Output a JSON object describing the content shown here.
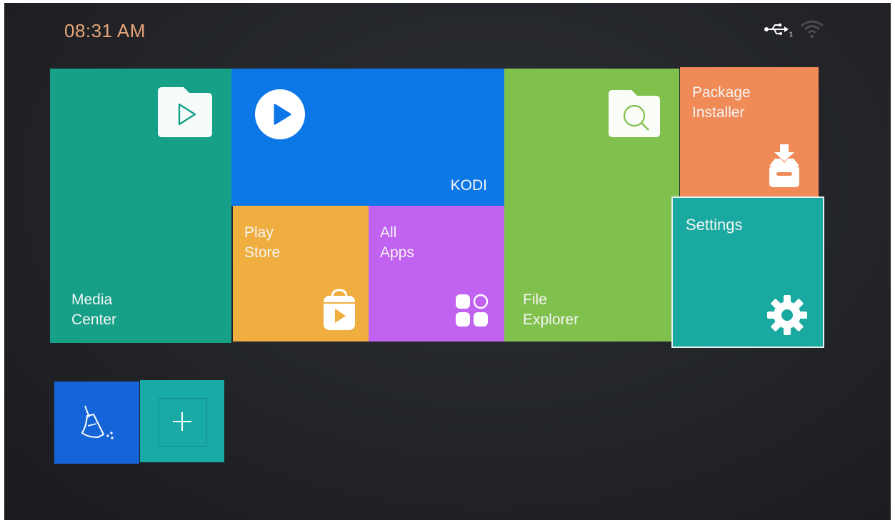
{
  "status_bar": {
    "time": "08:31 AM",
    "usb_icon": "usb-icon",
    "usb_count": "1",
    "wifi_icon": "wifi-icon"
  },
  "tiles": {
    "media_center": {
      "label": "Media\nCenter",
      "icon": "media-folder-icon",
      "color": "#16a088"
    },
    "kodi": {
      "label": "KODI",
      "icon": "kodi-play-icon",
      "color": "#0c78e8"
    },
    "play_store": {
      "label": "Play\nStore",
      "icon": "play-store-bag-icon",
      "color": "#efae3f"
    },
    "all_apps": {
      "label": "All\nApps",
      "icon": "apps-grid-icon",
      "color": "#c162f0"
    },
    "file_explorer": {
      "label": "File\nExplorer",
      "icon": "folder-search-icon",
      "color": "#80c14d"
    },
    "package_installer": {
      "label": "Package\nInstaller",
      "icon": "package-download-icon",
      "color": "#f08a57"
    },
    "settings": {
      "label": "Settings",
      "icon": "gear-icon",
      "color": "#1aa9a0"
    }
  },
  "shortcuts": {
    "cleaner": {
      "icon": "broom-icon",
      "color": "#1565d8"
    },
    "add": {
      "icon": "plus-icon",
      "color": "#19aaa6"
    }
  }
}
